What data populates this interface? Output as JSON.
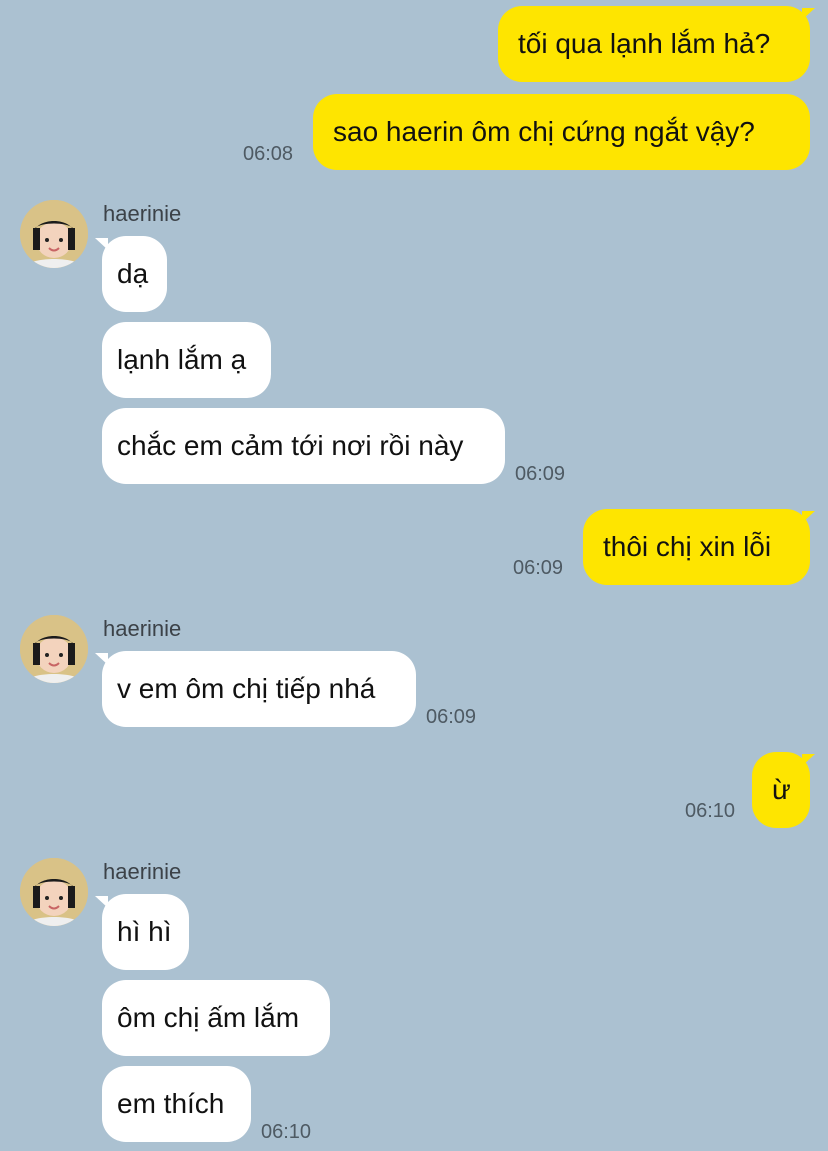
{
  "chat": {
    "contact_name": "haerinie",
    "messages": [
      {
        "from": "me",
        "text": "tối qua lạnh lắm hả?"
      },
      {
        "from": "me",
        "text": "sao haerin ôm chị cứng ngắt vậy?",
        "time": "06:08"
      },
      {
        "from": "haerinie",
        "text": "dạ"
      },
      {
        "from": "haerinie",
        "text": "lạnh lắm ạ"
      },
      {
        "from": "haerinie",
        "text": "chắc em cảm tới nơi rồi này",
        "time": "06:09"
      },
      {
        "from": "me",
        "text": "thôi chị xin lỗi",
        "time": "06:09"
      },
      {
        "from": "haerinie",
        "text": "v em ôm chị tiếp nhá",
        "time": "06:09"
      },
      {
        "from": "me",
        "text": "ừ",
        "time": "06:10"
      },
      {
        "from": "haerinie",
        "text": "hì hì"
      },
      {
        "from": "haerinie",
        "text": "ôm chị ấm lắm"
      },
      {
        "from": "haerinie",
        "text": "em thích",
        "time": "06:10"
      }
    ]
  },
  "colors": {
    "background": "#abc1d1",
    "my_bubble": "#fee500",
    "their_bubble": "#ffffff"
  }
}
